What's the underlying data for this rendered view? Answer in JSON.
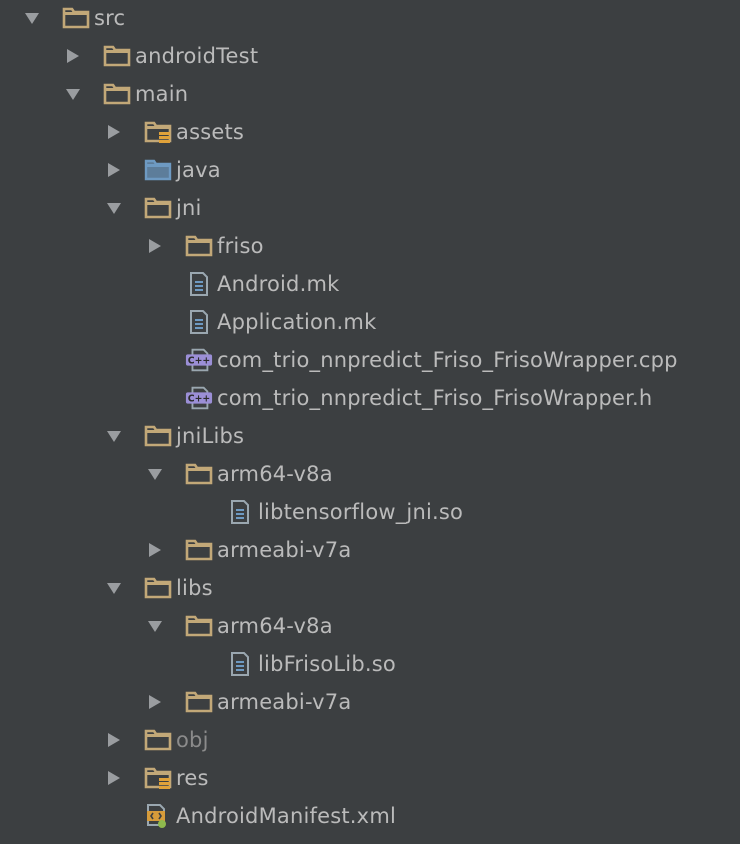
{
  "tree": [
    {
      "label": "src",
      "icon": "folder-icon",
      "state": "expanded",
      "depth": 0
    },
    {
      "label": "androidTest",
      "icon": "folder-icon",
      "state": "collapsed",
      "depth": 1
    },
    {
      "label": "main",
      "icon": "folder-icon",
      "state": "expanded",
      "depth": 1
    },
    {
      "label": "assets",
      "icon": "resource-folder-icon",
      "state": "collapsed",
      "depth": 2
    },
    {
      "label": "java",
      "icon": "source-folder-icon",
      "state": "collapsed",
      "depth": 2
    },
    {
      "label": "jni",
      "icon": "folder-icon",
      "state": "expanded",
      "depth": 2
    },
    {
      "label": "friso",
      "icon": "folder-icon",
      "state": "collapsed",
      "depth": 3
    },
    {
      "label": "Android.mk",
      "icon": "text-file-icon",
      "state": "leaf",
      "depth": 3
    },
    {
      "label": "Application.mk",
      "icon": "text-file-icon",
      "state": "leaf",
      "depth": 3
    },
    {
      "label": "com_trio_nnpredict_Friso_FrisoWrapper.cpp",
      "icon": "cpp-file-icon",
      "state": "leaf",
      "depth": 3
    },
    {
      "label": "com_trio_nnpredict_Friso_FrisoWrapper.h",
      "icon": "cpp-file-icon",
      "state": "leaf",
      "depth": 3
    },
    {
      "label": "jniLibs",
      "icon": "folder-icon",
      "state": "expanded",
      "depth": 2
    },
    {
      "label": "arm64-v8a",
      "icon": "folder-icon",
      "state": "expanded",
      "depth": 3
    },
    {
      "label": "libtensorflow_jni.so",
      "icon": "text-file-icon",
      "state": "leaf",
      "depth": 4
    },
    {
      "label": "armeabi-v7a",
      "icon": "folder-icon",
      "state": "collapsed",
      "depth": 3
    },
    {
      "label": "libs",
      "icon": "folder-icon",
      "state": "expanded",
      "depth": 2
    },
    {
      "label": "arm64-v8a",
      "icon": "folder-icon",
      "state": "expanded",
      "depth": 3
    },
    {
      "label": "libFrisoLib.so",
      "icon": "text-file-icon",
      "state": "leaf",
      "depth": 4
    },
    {
      "label": "armeabi-v7a",
      "icon": "folder-icon",
      "state": "collapsed",
      "depth": 3
    },
    {
      "label": "obj",
      "icon": "folder-icon",
      "state": "collapsed",
      "depth": 2,
      "muted": true
    },
    {
      "label": "res",
      "icon": "resource-folder-icon",
      "state": "collapsed",
      "depth": 2
    },
    {
      "label": "AndroidManifest.xml",
      "icon": "manifest-file-icon",
      "state": "leaf",
      "depth": 2
    }
  ],
  "colors": {
    "background": "#3c3f41",
    "text": "#bbbbbb",
    "muted_text": "#8b8b8b",
    "arrow": "#9a9da0",
    "folder": "#c2a878",
    "source_folder": "#6e9ac2",
    "file": "#9aa7b0",
    "cpp_badge": "#9b8fd6"
  }
}
